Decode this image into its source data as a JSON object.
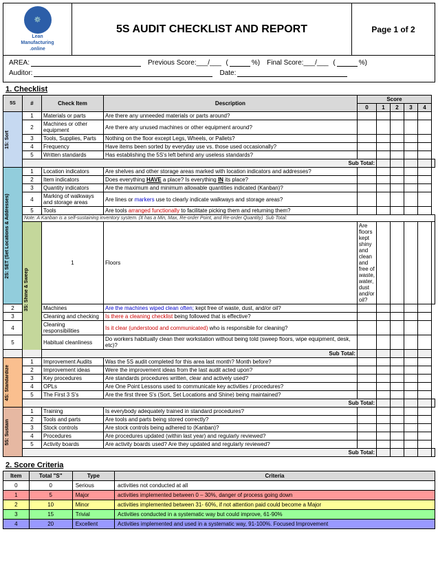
{
  "header": {
    "logo_line1": "Lean",
    "logo_line2": "Manufacturing",
    "logo_line3": ".online",
    "title": "5S AUDIT CHECKLIST AND REPORT",
    "page": "Page 1 of 2"
  },
  "info": {
    "area_label": "AREA:",
    "prev_score_label": "Previous Score:___/___",
    "percent_open": "(",
    "percent_close": "%)",
    "final_score_label": "Final Score:___/___",
    "auditor_label": "Auditor:",
    "date_label": "Date:"
  },
  "checklist": {
    "section_title": "1. Checklist",
    "headers": {
      "s5": "5S",
      "num": "#",
      "check_item": "Check Item",
      "description": "Description",
      "score": "Score",
      "score_cols": [
        "0",
        "1",
        "2",
        "3",
        "4"
      ]
    },
    "groups": [
      {
        "label": "1S: Sort",
        "label_class": "sort-label",
        "items": [
          {
            "num": "1",
            "check": "Materials or parts",
            "desc": "Are there any unneeded materials or parts around?"
          },
          {
            "num": "2",
            "check": "Machines or other equipment",
            "desc": "Are there any unused machines or other equipment around?"
          },
          {
            "num": "3",
            "check": "Tools, Supplies, Parts",
            "desc": "Nothing on the floor except Legs, Wheels, or Pallets?"
          },
          {
            "num": "4",
            "check": "Frequency",
            "desc": "Have items been sorted by everyday use vs. those used occasionally?"
          },
          {
            "num": "5",
            "check": "Written standards",
            "desc": "Has establishing the 5S's left behind any useless standards?"
          }
        ],
        "subtotal": "Sub Total:"
      },
      {
        "label": "2S: SET (Set Locations & Addresses)",
        "label_class": "set-label",
        "items": [
          {
            "num": "1",
            "check": "Location indicators",
            "desc": "Are shelves and other storage areas marked with location indicators and addresses?"
          },
          {
            "num": "2",
            "check": "Item indicators",
            "desc": "Does everything HAVE a place?  Is everything IN its place?",
            "highlight": "HAVE,IN"
          },
          {
            "num": "3",
            "check": "Quantity indicators",
            "desc": "Are the maximum and minimum allowable quantities indicated (Kanban)?"
          },
          {
            "num": "4",
            "check": "Marking of walkways and storage areas",
            "desc": "Are lines or markers use to clearly indicate walkways and storage areas?",
            "highlight_blue": "markers"
          },
          {
            "num": "5",
            "check": "Tools",
            "desc": "Are tools arranged functionally to facilitate picking them and returning them?",
            "highlight_red": "arranged functionally"
          }
        ],
        "note": "Note: A Kanban is a self-sustaining inventory system. (It has a Min, Max, Re-order Point, and Re-order Quantity)",
        "subtotal": "Sub Total:"
      },
      {
        "label": "3S: Shine & Sweep",
        "label_class": "shine-label",
        "items": [
          {
            "num": "1",
            "check": "Floors",
            "desc": "Are floors kept shiny and clean and free of waste, water, dust and/or oil?"
          },
          {
            "num": "2",
            "check": "Machines",
            "desc": "Are the machines wiped clean often; kept free of waste, dust, and/or oil?",
            "highlight_blue": "machines wiped clean often"
          },
          {
            "num": "3",
            "check": "Cleaning and checking",
            "desc": "Is there a cleaning checklist being followed that is effective?",
            "highlight_red": "Is there a cleaning checklist"
          },
          {
            "num": "4",
            "check": "Cleaning responsibilities",
            "desc": "Is it clear (understood and communicated) who is responsible for cleaning?",
            "highlight_red": "Is it clear (understood and communicated)"
          },
          {
            "num": "5",
            "check": "Habitual cleanliness",
            "desc": "Do workers habitually clean their workstation without being told (sweep floors, wipe equipment, desk, etc)?"
          }
        ],
        "subtotal": "Sub Total:"
      },
      {
        "label": "4S: Standardize",
        "label_class": "std-label",
        "items": [
          {
            "num": "1",
            "check": "Improvement Audits",
            "desc": "Was the 5S audit completed for this area last month? Month before?"
          },
          {
            "num": "2",
            "check": "Improvement ideas",
            "desc": "Were the improvement ideas from the last audit acted upon?"
          },
          {
            "num": "3",
            "check": "Key procedures",
            "desc": "Are standards procedures written, clear and actively used?"
          },
          {
            "num": "4",
            "check": "OPLs",
            "desc": "Are One Point Lessons used to communicate key activities / procedures?"
          },
          {
            "num": "5",
            "check": "The First 3 S's",
            "desc": "Are the first three S's (Sort, Set Locations and Shine) being maintained?"
          }
        ],
        "subtotal": "Sub Total:"
      },
      {
        "label": "5S: Sustain",
        "label_class": "sustain-label",
        "items": [
          {
            "num": "1",
            "check": "Training",
            "desc": "Is everybody adequately trained in standard procedures?"
          },
          {
            "num": "2",
            "check": "Tools and parts",
            "desc": "Are tools and parts being stored correctly?"
          },
          {
            "num": "3",
            "check": "Stock controls",
            "desc": "Are stock controls being adhered to (Kanban)?"
          },
          {
            "num": "4",
            "check": "Procedures",
            "desc": "Are procedures updated (within last year) and regularly reviewed?"
          },
          {
            "num": "5",
            "check": "Activity boards",
            "desc": "Are activity boards used?  Are they updated and regularly reviewed?"
          }
        ],
        "subtotal": "Sub Total:"
      }
    ]
  },
  "score_criteria": {
    "section_title": "2. Score Criteria",
    "headers": [
      "Item",
      "Total \"S\"",
      "Type",
      "Criteria"
    ],
    "rows": [
      {
        "item": "0",
        "total": "0",
        "type": "Serious",
        "criteria": "activities not conducted at all",
        "row_class": "row-0"
      },
      {
        "item": "1",
        "total": "5",
        "type": "Major",
        "criteria": "activities implemented between 0 – 30%, danger of process going down",
        "row_class": "row-1"
      },
      {
        "item": "2",
        "total": "10",
        "type": "Minor",
        "criteria": "activities implemented between 31- 60%, if not attention paid could become a Major",
        "row_class": "row-2"
      },
      {
        "item": "3",
        "total": "15",
        "type": "Trivial",
        "criteria": "Activities conducted in a systematic way but could improve, 61-90%",
        "row_class": "row-3"
      },
      {
        "item": "4",
        "total": "20",
        "type": "Excellent",
        "criteria": "Activities implemented and used in a systematic way, 91-100%. Focused Improvement",
        "row_class": "row-4"
      }
    ]
  }
}
